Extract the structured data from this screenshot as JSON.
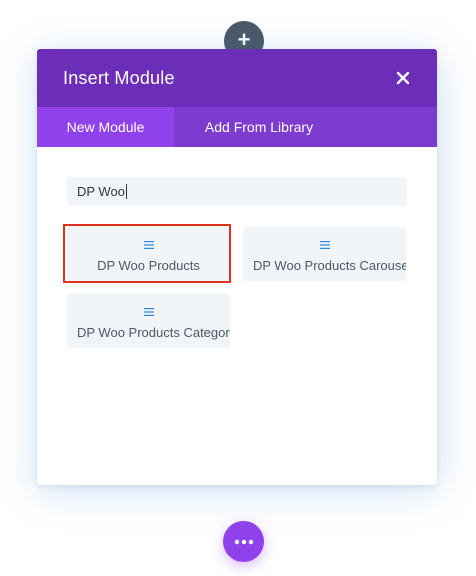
{
  "modal": {
    "title": "Insert Module",
    "close_icon": "close-icon"
  },
  "tabs": [
    {
      "label": "New Module",
      "active": true
    },
    {
      "label": "Add From Library",
      "active": false
    }
  ],
  "search": {
    "value": "DP Woo"
  },
  "modules": [
    {
      "label": "DP Woo Products",
      "icon": "menu-lines-icon",
      "highlighted": true
    },
    {
      "label": "DP Woo Products Carousel",
      "icon": "menu-lines-icon",
      "highlighted": false
    },
    {
      "label": "DP Woo Products Category",
      "icon": "menu-lines-icon",
      "highlighted": false
    }
  ],
  "controls": {
    "top_button_icon": "plus-icon",
    "bottom_button_icon": "more-dots-icon"
  },
  "colors": {
    "header": "#6c2eb9",
    "tabs_bar": "#7e3bd0",
    "active_tab": "#8f42ec",
    "module_bg": "#f1f5f9",
    "highlight_border": "#e0301e",
    "top_circle": "#4c5866",
    "bottom_button": "#8f42ec"
  }
}
